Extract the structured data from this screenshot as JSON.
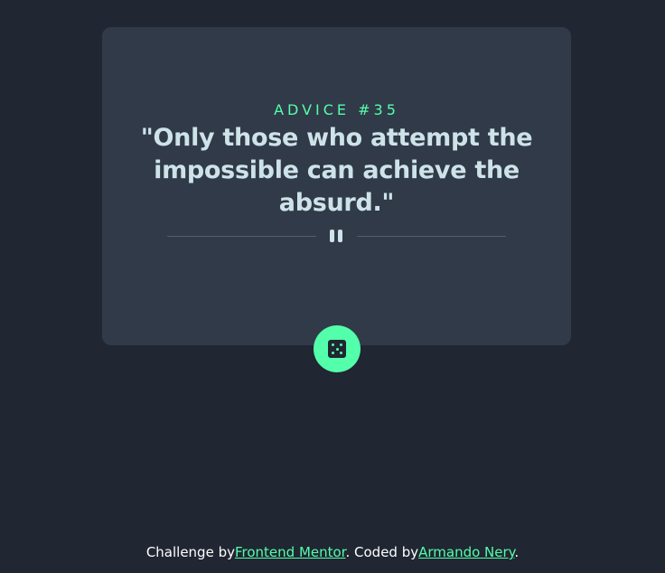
{
  "card": {
    "advice_label": "ADVICE #35",
    "quote": "\"Only those who attempt the impossible can achieve the absurd.\""
  },
  "divider": {
    "icon": "pause-icon"
  },
  "dice_button": {
    "icon": "dice-icon"
  },
  "footer": {
    "challenge_prefix": "Challenge by",
    "challenge_link": "Frontend Mentor",
    "coded_prefix": ". Coded by",
    "coded_link": "Armando Nery",
    "suffix": "."
  },
  "colors": {
    "background": "#202632",
    "card": "#313a48",
    "accent": "#53ffaa",
    "text": "#cee3e9"
  }
}
